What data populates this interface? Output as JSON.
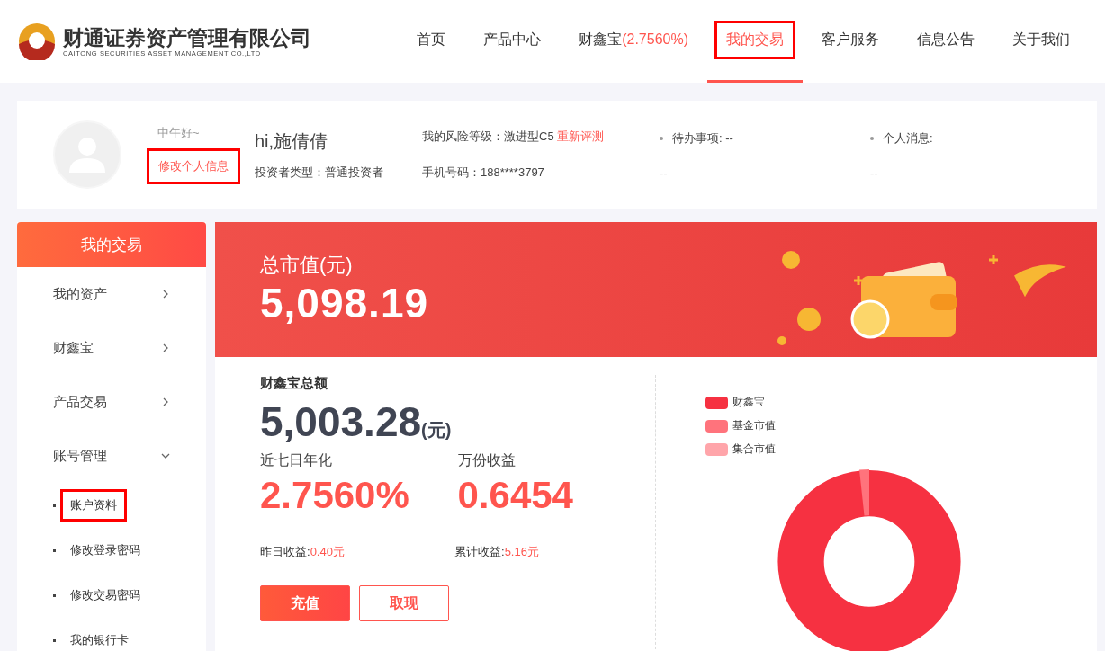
{
  "logo": {
    "name": "财通证券资产管理有限公司",
    "subtitle": "CAITONG SECURITIES ASSET MANAGEMENT CO.,LTD"
  },
  "nav": [
    {
      "label": "首页",
      "selected": false,
      "highlighted": false
    },
    {
      "label": "产品中心",
      "selected": false,
      "highlighted": false
    },
    {
      "label": "财鑫宝",
      "rate": "(2.7560%)",
      "selected": false,
      "highlighted": false
    },
    {
      "label": "我的交易",
      "selected": true,
      "highlighted": true
    },
    {
      "label": "客户服务",
      "selected": false,
      "highlighted": false
    },
    {
      "label": "信息公告",
      "selected": false,
      "highlighted": false
    },
    {
      "label": "关于我们",
      "selected": false,
      "highlighted": false
    }
  ],
  "user": {
    "greeting": "中午好~",
    "edit_link": {
      "label": "修改个人信息",
      "highlighted": true
    },
    "name": "hi,施倩倩",
    "investor_type": "投资者类型：普通投资者",
    "risk_level": "我的风险等级：激进型C5",
    "retest_link": "重新评测",
    "phone": "手机号码：188****3797",
    "todo": {
      "label": "待办事项: --",
      "value": "--"
    },
    "messages": {
      "label": "个人消息:",
      "value": "--"
    }
  },
  "sidebar": {
    "title": "我的交易",
    "items": [
      {
        "label": "我的资产",
        "expanded": false
      },
      {
        "label": "财鑫宝",
        "expanded": false
      },
      {
        "label": "产品交易",
        "expanded": false
      },
      {
        "label": "账号管理",
        "expanded": true,
        "children": [
          {
            "label": "账户资料",
            "selected": true
          },
          {
            "label": "修改登录密码",
            "selected": false
          },
          {
            "label": "修改交易密码",
            "selected": false
          },
          {
            "label": "我的银行卡",
            "selected": false
          }
        ]
      }
    ]
  },
  "banner": {
    "label": "总市值(元)",
    "value": "5,098.19"
  },
  "fund": {
    "title": "财鑫宝总额",
    "total": "5,003.28",
    "unit": "(元)",
    "yield_label": "近七日年化",
    "yield_value": "2.7560%",
    "per10k_label": "万份收益",
    "per10k_value": "0.6454",
    "yesterday_label": "昨日收益:",
    "yesterday_value": "0.40元",
    "cumulative_label": "累计收益:",
    "cumulative_value": "5.16元",
    "buttons": [
      {
        "label": "充值",
        "kind": "primary"
      },
      {
        "label": "取现",
        "kind": "outline"
      }
    ]
  },
  "legend": [
    {
      "label": "财鑫宝",
      "color": "#f63141"
    },
    {
      "label": "基金市值",
      "color": "#ff737c"
    },
    {
      "label": "集合市值",
      "color": "#ffa5aa"
    }
  ]
}
